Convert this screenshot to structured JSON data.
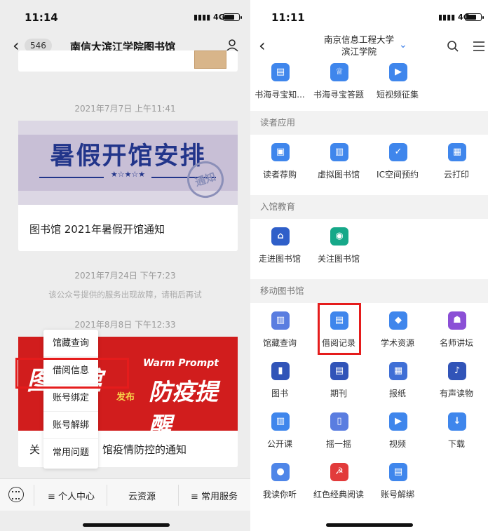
{
  "left": {
    "status": {
      "time": "11:14",
      "network": "4G"
    },
    "nav": {
      "back_count": "546",
      "title": "南信大滨江学院图书馆"
    },
    "messages": [
      {
        "timestamp": "2021年7月7日 上午11:41",
        "banner_text": "暑假开馆安排",
        "banner_stamp": "通知",
        "title": "图书馆 2021年暑假开馆通知"
      },
      {
        "timestamp": "2021年7月24日 下午7:23",
        "service_notice": "该公众号提供的服务出现故障，请稍后再试"
      },
      {
        "timestamp": "2021年8月8日 下午12:33",
        "banner_left": "图书馆",
        "banner_warm": "Warm Prompt",
        "banner_sub": "防疫提醒",
        "banner_pub": "发布",
        "title_left": "关",
        "title_right": "馆疫情防控的通知"
      }
    ],
    "popup_menu": [
      "馆藏查询",
      "借阅信息",
      "账号绑定",
      "账号解绑",
      "常用问题"
    ],
    "bottom_menu": [
      "个人中心",
      "云资源",
      "常用服务"
    ]
  },
  "right": {
    "status": {
      "time": "11:11",
      "network": "4G"
    },
    "nav": {
      "title": "南京信息工程大学滨江学院"
    },
    "top_apps": [
      {
        "label": "书海寻宝知...",
        "icon": "book-icon",
        "color": "#3f86ec"
      },
      {
        "label": "书海寻宝答题",
        "icon": "trophy-icon",
        "color": "#3f86ec"
      },
      {
        "label": "短视频征集",
        "icon": "video-icon",
        "color": "#3f86ec"
      }
    ],
    "sections": [
      {
        "header": "读者应用",
        "apps": [
          {
            "label": "读者荐购",
            "icon": "cart-icon",
            "color": "#3f86ec"
          },
          {
            "label": "虚拟图书馆",
            "icon": "library-icon",
            "color": "#3f86ec"
          },
          {
            "label": "IC空间预约",
            "icon": "calendar-icon",
            "color": "#3f86ec"
          },
          {
            "label": "云打印",
            "icon": "printer-icon",
            "color": "#3f86ec"
          }
        ]
      },
      {
        "header": "入馆教育",
        "apps": [
          {
            "label": "走进图书馆",
            "icon": "building-icon",
            "color": "#2f5fc9"
          },
          {
            "label": "关注图书馆",
            "icon": "eye-icon",
            "color": "#16a889"
          }
        ]
      },
      {
        "header": "移动图书馆",
        "apps": [
          {
            "label": "馆藏查询",
            "icon": "collection-icon",
            "color": "#5a7de0"
          },
          {
            "label": "借阅记录",
            "icon": "record-icon",
            "color": "#3f86ec"
          },
          {
            "label": "学术资源",
            "icon": "academic-icon",
            "color": "#3f86ec"
          },
          {
            "label": "名师讲坛",
            "icon": "lecture-icon",
            "color": "#8b4fd6"
          },
          {
            "label": "图书",
            "icon": "books-icon",
            "color": "#3154b8"
          },
          {
            "label": "期刊",
            "icon": "journal-icon",
            "color": "#3154b8"
          },
          {
            "label": "报纸",
            "icon": "newspaper-icon",
            "color": "#3f6fd6"
          },
          {
            "label": "有声读物",
            "icon": "audio-icon",
            "color": "#3154b8"
          },
          {
            "label": "公开课",
            "icon": "course-icon",
            "color": "#3f86ec"
          },
          {
            "label": "摇一摇",
            "icon": "shake-icon",
            "color": "#5a7de0"
          },
          {
            "label": "视频",
            "icon": "play-icon",
            "color": "#3f86ec"
          },
          {
            "label": "下载",
            "icon": "download-icon",
            "color": "#3f86ec"
          },
          {
            "label": "我读你听",
            "icon": "mic-icon",
            "color": "#4f86e8"
          },
          {
            "label": "红色经典阅读",
            "icon": "hammer-sickle-icon",
            "color": "#e23b3b"
          },
          {
            "label": "账号解绑",
            "icon": "unbind-icon",
            "color": "#3f86ec"
          }
        ]
      }
    ]
  },
  "colors": {
    "highlight": "#e51c1c",
    "accent": "#3f86ec"
  }
}
